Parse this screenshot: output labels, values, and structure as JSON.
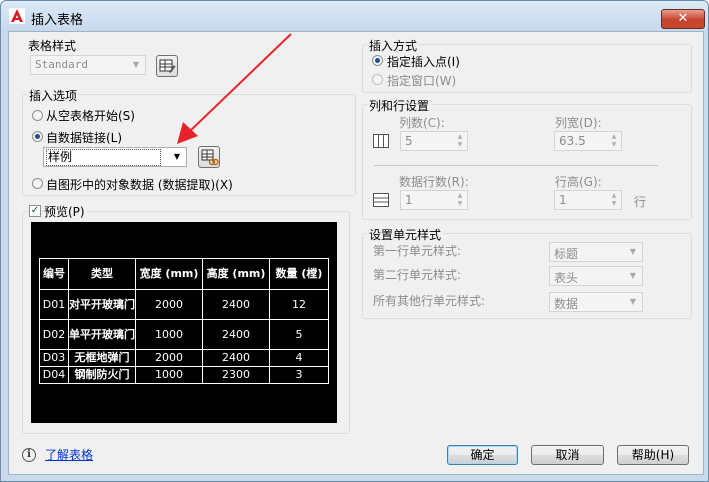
{
  "window": {
    "title": "插入表格"
  },
  "colors": {
    "accent": "#1c4f8f",
    "arrow": "#e8222a",
    "close": "#c7482f"
  },
  "table_style": {
    "label": "表格样式",
    "value": "Standard"
  },
  "insert_options": {
    "label": "插入选项",
    "empty": "从空表格开始(S)",
    "datalink": "自数据链接(L)",
    "datalink_value": "样例",
    "object_data": "自图形中的对象数据 (数据提取)(X)"
  },
  "preview": {
    "label": "预览(P)",
    "headers": [
      "编号",
      "类型",
      "宽度 (mm)",
      "高度 (mm)",
      "数量 (樘)"
    ],
    "rows": [
      [
        "D01",
        "对平开玻璃门",
        "2000",
        "2400",
        "12"
      ],
      [
        "D02",
        "单平开玻璃门",
        "1000",
        "2400",
        "5"
      ],
      [
        "D03",
        "无框地弹门",
        "2000",
        "2400",
        "4"
      ],
      [
        "D04",
        "钢制防火门",
        "1000",
        "2300",
        "3"
      ]
    ]
  },
  "insert_method": {
    "label": "插入方式",
    "point": "指定插入点(I)",
    "window": "指定窗口(W)"
  },
  "columns_rows": {
    "label": "列和行设置",
    "columns_label": "列数(C):",
    "columns_value": "5",
    "col_width_label": "列宽(D):",
    "col_width_value": "63.5",
    "data_rows_label": "数据行数(R):",
    "data_rows_value": "1",
    "row_height_label": "行高(G):",
    "row_height_value": "1",
    "row_unit": "行"
  },
  "cell_styles": {
    "label": "设置单元样式",
    "first_row_label": "第一行单元样式:",
    "first_row_value": "标题",
    "second_row_label": "第二行单元样式:",
    "second_row_value": "表头",
    "other_rows_label": "所有其他行单元样式:",
    "other_rows_value": "数据"
  },
  "footer": {
    "learn": "了解表格",
    "ok": "确定",
    "cancel": "取消",
    "help": "帮助(H)"
  }
}
